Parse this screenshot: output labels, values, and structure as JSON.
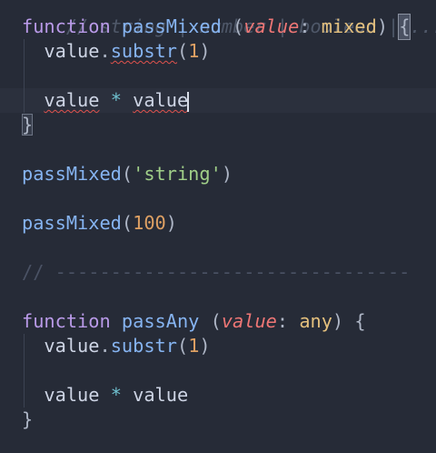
{
  "code": {
    "line0": {
      "text": "// string | number | boolean | ...."
    },
    "line1": {
      "kw": "function",
      "name": "passMixed",
      "open": "(",
      "param": "value",
      "colon": ":",
      "type": "mixed",
      "close": ")",
      "brace": "{"
    },
    "line2": {
      "obj": "value",
      "dot": ".",
      "method": "substr",
      "open": "(",
      "num": "1",
      "close": ")"
    },
    "line4": {
      "left": "value",
      "op": "*",
      "right": "value"
    },
    "line5": {
      "brace": "}"
    },
    "line7": {
      "fn": "passMixed",
      "open": "(",
      "str": "'string'",
      "close": ")"
    },
    "line9": {
      "fn": "passMixed",
      "open": "(",
      "num": "100",
      "close": ")"
    },
    "line11": {
      "text": "// --------------------------------"
    },
    "line13": {
      "kw": "function",
      "name": "passAny",
      "open": "(",
      "param": "value",
      "colon": ":",
      "type": "any",
      "close": ")",
      "brace": "{"
    },
    "line14": {
      "obj": "value",
      "dot": ".",
      "method": "substr",
      "open": "(",
      "num": "1",
      "close": ")"
    },
    "line16": {
      "left": "value",
      "op": "*",
      "right": "value"
    },
    "line17": {
      "brace": "}"
    }
  },
  "colors": {
    "background": "#262b37",
    "keyword": "#b99ae8",
    "function": "#86b4f1",
    "parameter": "#ee7675",
    "type": "#e4c07d",
    "string": "#a0cf88",
    "number": "#dea063",
    "operator": "#6fc0cf",
    "comment": "#4f5869",
    "error_squiggle": "#e0524d"
  }
}
